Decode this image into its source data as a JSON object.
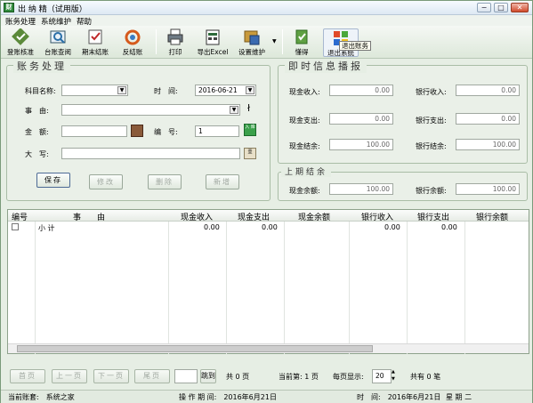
{
  "window": {
    "title": "出 纳 精（试用版）",
    "app_icon": "财",
    "min": "−",
    "max": "□",
    "close": "✕"
  },
  "menu": [
    "账务处理",
    "系统维护",
    "帮助"
  ],
  "toolbar": [
    {
      "label": "登账核准",
      "icon": "approve-icon"
    },
    {
      "label": "台账查阅",
      "icon": "ledger-icon"
    },
    {
      "label": "期末结账",
      "icon": "period-close-icon"
    },
    {
      "label": "反结账",
      "icon": "reverse-close-icon"
    },
    {
      "label": "打印",
      "icon": "printer-icon"
    },
    {
      "label": "导出Excel",
      "icon": "excel-icon"
    },
    {
      "label": "设置维护",
      "icon": "settings-icon"
    },
    {
      "label": "懂得",
      "icon": "help-icon"
    },
    {
      "label": "退出系统",
      "icon": "exit-icon"
    }
  ],
  "tooltip": "退出账务",
  "form": {
    "title": "账务处理",
    "subject_label": "科目名称:",
    "time_label": "时　间:",
    "date_value": "2016-06-21",
    "reason_label": "事　由:",
    "amount_label": "金　额:",
    "number_label": "编　号:",
    "number_value": "1",
    "capital_label": "大　写:",
    "save": "保存",
    "edit": "修改",
    "delete": "删除",
    "add": "新增"
  },
  "broadcast": {
    "title": "即时信息播报",
    "cash_in_label": "现金收入:",
    "cash_in": "0.00",
    "bank_in_label": "银行收入:",
    "bank_in": "0.00",
    "cash_out_label": "现金支出:",
    "cash_out": "0.00",
    "bank_out_label": "银行支出:",
    "bank_out": "0.00",
    "cash_bal_label": "现金结余:",
    "cash_bal": "100.00",
    "bank_bal_label": "银行结余:",
    "bank_bal": "100.00"
  },
  "prior": {
    "title": "上期结余",
    "cash_label": "现金余额:",
    "cash": "100.00",
    "bank_label": "银行余额:",
    "bank": "100.00"
  },
  "grid": {
    "headers": [
      "编号",
      "事　　由",
      "现金收入",
      "现金支出",
      "现金余额",
      "银行收入",
      "银行支出",
      "银行余额"
    ],
    "row": {
      "label": "小 计",
      "cash_in": "0.00",
      "cash_out": "0.00",
      "bank_in": "0.00",
      "bank_out": "0.00"
    }
  },
  "pager": {
    "first": "首页",
    "prev": "上一页",
    "next": "下一页",
    "last": "尾页",
    "jump": "跳到",
    "total_pages": "共 0 页",
    "current": "当前第: 1 页",
    "per_page_label": "每页显示:",
    "per_page": "20",
    "total_records": "共有 0 笔"
  },
  "status": {
    "account": "当前账套:　系统之家",
    "op_date": "操 作 期 间:　2016年6月21日",
    "time": "时　间:　2016年6月21日",
    "weekday": "星 期 二"
  }
}
